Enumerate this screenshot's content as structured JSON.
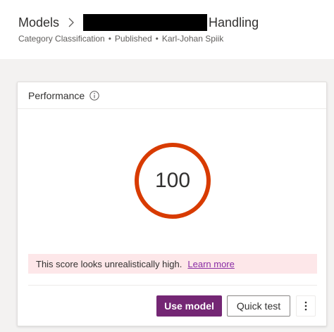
{
  "breadcrumb": {
    "root": "Models",
    "current": "Handling"
  },
  "meta": {
    "category": "Category Classification",
    "status": "Published",
    "author": "Karl-Johan Spiik"
  },
  "performance": {
    "title": "Performance",
    "info_icon": "info-icon",
    "score": "100",
    "score_color": "#d83b01",
    "warning_text": "This score looks unrealistically high.",
    "learn_more": "Learn more",
    "warning_bg": "#fde7e9"
  },
  "actions": {
    "use_model": "Use model",
    "quick_test": "Quick test",
    "more_icon": "more-vertical-icon",
    "primary_color": "#742774"
  }
}
